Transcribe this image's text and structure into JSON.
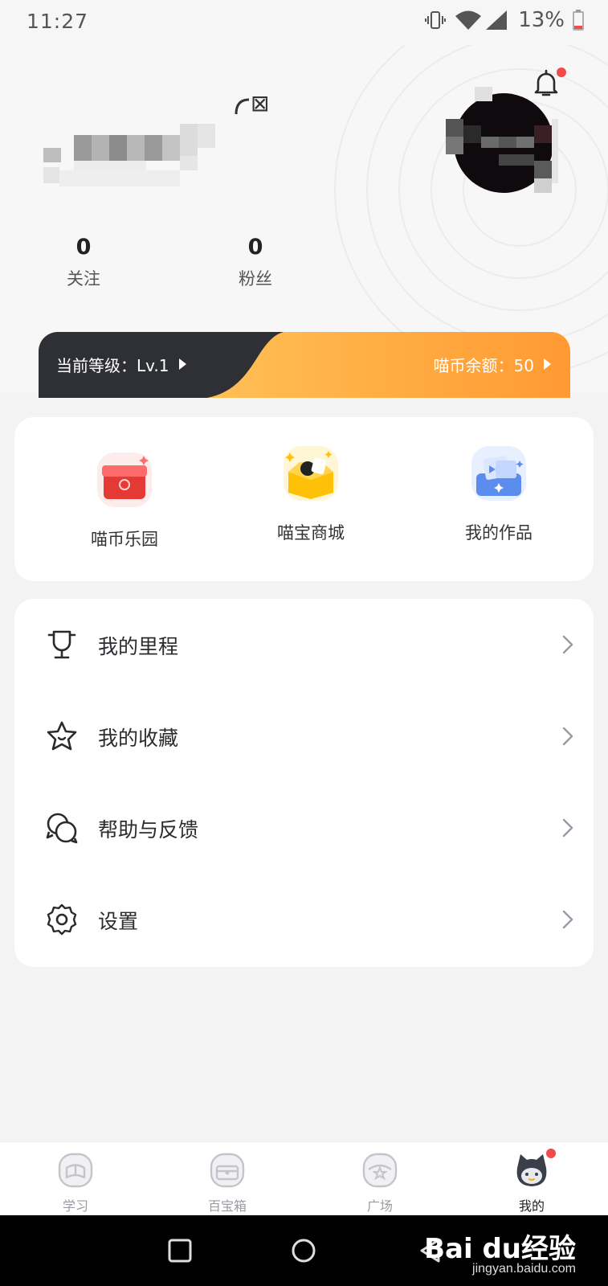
{
  "status_bar": {
    "time": "11:27",
    "battery": "13%"
  },
  "profile": {
    "name_suffix": "⊠",
    "stats": [
      {
        "value": "0",
        "label": "关注"
      },
      {
        "value": "0",
        "label": "粉丝"
      }
    ]
  },
  "level_bar": {
    "level_text": "当前等级：Lv.1",
    "coins_text": "喵币余额：50"
  },
  "quick_actions": [
    {
      "label": "喵币乐园",
      "icon": "red-treasure-chest-icon"
    },
    {
      "label": "喵宝商城",
      "icon": "yellow-gift-box-icon"
    },
    {
      "label": "我的作品",
      "icon": "blue-works-box-icon"
    }
  ],
  "menu": [
    {
      "label": "我的里程",
      "icon": "trophy-icon"
    },
    {
      "label": "我的收藏",
      "icon": "star-icon"
    },
    {
      "label": "帮助与反馈",
      "icon": "chat-bubbles-icon"
    },
    {
      "label": "设置",
      "icon": "gear-icon"
    }
  ],
  "tabs": [
    {
      "label": "学习",
      "icon": "study-icon",
      "active": false
    },
    {
      "label": "百宝箱",
      "icon": "toolbox-icon",
      "active": false
    },
    {
      "label": "广场",
      "icon": "plaza-icon",
      "active": false
    },
    {
      "label": "我的",
      "icon": "cat-avatar-icon",
      "active": true
    }
  ],
  "watermark": {
    "brand": "Bai du经验",
    "url": "jingyan.baidu.com"
  },
  "colors": {
    "notification_dot": "#f04a4a",
    "level_dark": "#2f3036",
    "coins_gradient_start": "#ffd166",
    "coins_gradient_end": "#ff9a32"
  }
}
